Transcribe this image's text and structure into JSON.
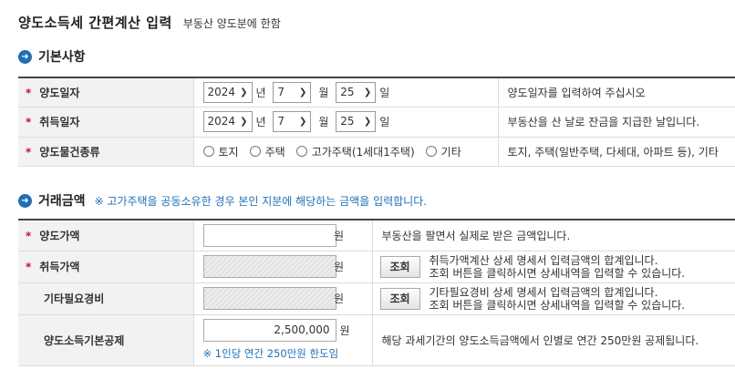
{
  "header": {
    "title": "양도소득세 간편계산 입력",
    "subtitle": "부동산 양도분에 한함"
  },
  "basic": {
    "section_title": "기본사항",
    "required_mark": "*",
    "rows": [
      {
        "label": "양도일자",
        "year": "2024",
        "year_unit": "년",
        "month": "7",
        "month_unit": "월",
        "day": "25",
        "day_unit": "일",
        "desc": "양도일자를 입력하여 주십시오"
      },
      {
        "label": "취득일자",
        "year": "2024",
        "year_unit": "년",
        "month": "7",
        "month_unit": "월",
        "day": "25",
        "day_unit": "일",
        "desc": "부동산을 산 날로 잔금을 지급한 날입니다."
      }
    ],
    "type_row": {
      "label": "양도물건종류",
      "options": [
        "토지",
        "주택",
        "고가주택(1세대1주택)",
        "기타"
      ],
      "desc": "토지, 주택(일반주택, 다세대, 아파트 등), 기타"
    }
  },
  "trade": {
    "section_title": "거래금액",
    "section_note": "※ 고가주택을 공동소유한 경우 본인 지분에 해당하는 금액을 입력합니다.",
    "won": "원",
    "sale_price": {
      "label": "양도가액",
      "value": "",
      "desc": "부동산을 팔면서 실제로 받은 금액입니다."
    },
    "acq_price": {
      "label": "취득가액",
      "button": "조회",
      "desc1": "취득가액계산 상세 명세서 입력금액의 합계입니다.",
      "desc2": "조회 버튼을 클릭하시면 상세내역을 입력할 수 있습니다."
    },
    "other_cost": {
      "label": "기타필요경비",
      "button": "조회",
      "desc1": "기타필요경비 상세 명세서 입력금액의 합계입니다.",
      "desc2": "조회 버튼을 클릭하시면 상세내역을 입력할 수 있습니다."
    },
    "basic_deduction": {
      "label": "양도소득기본공제",
      "value": "2,500,000",
      "note": "※ 1인당 연간 250만원 한도임",
      "desc": "해당 과세기간의 양도소득금액에서 인별로 연간 250만원 공제됩니다."
    }
  }
}
